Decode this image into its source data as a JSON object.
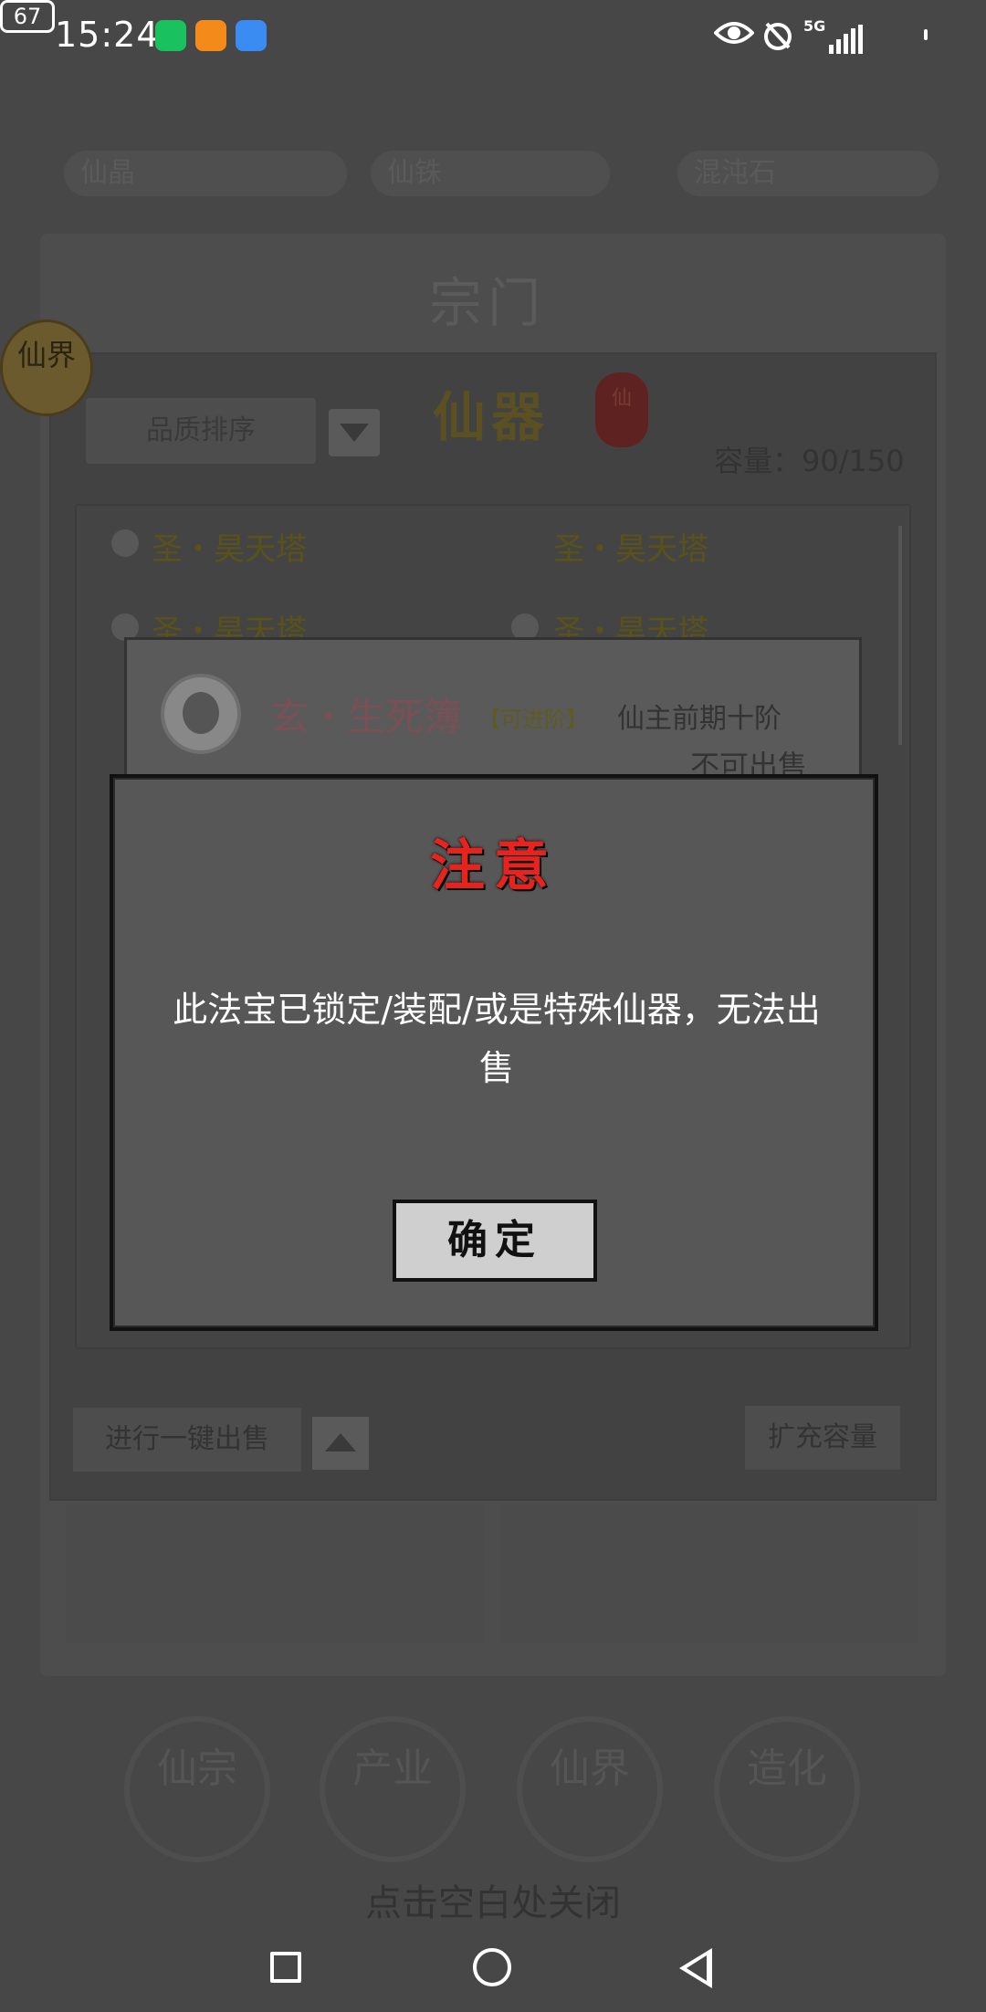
{
  "status_bar": {
    "time": "15:24",
    "app_icons": [
      "wechat-icon",
      "uc-browser-icon",
      "cloud-icon"
    ],
    "network": "5G",
    "battery": "67"
  },
  "game": {
    "resources": [
      "仙晶",
      "仙铢",
      "混沌石"
    ],
    "zongmen_title": "宗门",
    "xianjie_badge": "仙界",
    "panel_title": "仙器",
    "seal_text": "仙",
    "sort_label": "品质排序",
    "capacity": "容量：90/150",
    "list_items": [
      {
        "name": "圣・昊天塔"
      },
      {
        "name": "圣・昊天塔"
      },
      {
        "name": "圣・昊天塔"
      },
      {
        "name": "圣・昊天塔"
      }
    ],
    "sell_all_label": "进行一键出售",
    "expand_label": "扩充容量",
    "bottom_nav": [
      "仙宗",
      "产业",
      "仙界",
      "造化"
    ],
    "close_hint": "点击空白处关闭"
  },
  "detail": {
    "name": "玄・生死簿",
    "tag": "【可进阶】",
    "rank": "仙主前期十阶",
    "sale_status": "不可出售"
  },
  "modal": {
    "title": "注意",
    "message": "此法宝已锁定/装配/或是特殊仙器，无法出售",
    "ok_label": "确定"
  },
  "colors": {
    "modal_title": "#e8231d",
    "overlay": "#474747"
  }
}
